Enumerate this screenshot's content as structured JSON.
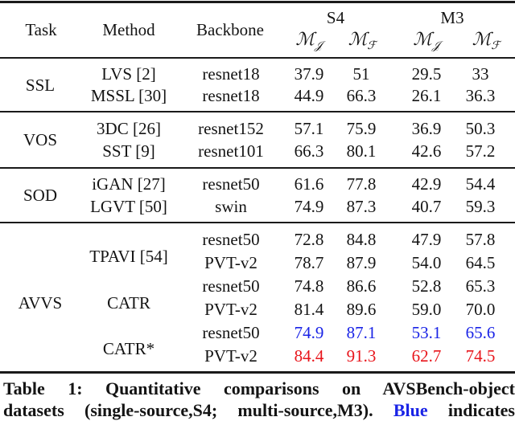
{
  "header": {
    "task": "Task",
    "method": "Method",
    "backbone": "Backbone",
    "groups": [
      "S4",
      "M3"
    ],
    "metric_main": "ℳ",
    "metric_j_sub": "𝒥",
    "metric_f_sub": "ℱ"
  },
  "colors": {
    "second_best": "#1a24e6",
    "best": "#e8151b",
    "text": "#141414"
  },
  "rows": [
    {
      "task": "SSL",
      "method": "LVS [2]",
      "backbone": "resnet18",
      "s4_j": "37.9",
      "s4_f": "51",
      "m3_j": "29.5",
      "m3_f": "33",
      "highlight": "none"
    },
    {
      "task": "",
      "method": "MSSL [30]",
      "backbone": "resnet18",
      "s4_j": "44.9",
      "s4_f": "66.3",
      "m3_j": "26.1",
      "m3_f": "36.3",
      "highlight": "none"
    },
    {
      "task": "VOS",
      "method": "3DC [26]",
      "backbone": "resnet152",
      "s4_j": "57.1",
      "s4_f": "75.9",
      "m3_j": "36.9",
      "m3_f": "50.3",
      "highlight": "none"
    },
    {
      "task": "",
      "method": "SST [9]",
      "backbone": "resnet101",
      "s4_j": "66.3",
      "s4_f": "80.1",
      "m3_j": "42.6",
      "m3_f": "57.2",
      "highlight": "none"
    },
    {
      "task": "SOD",
      "method": "iGAN [27]",
      "backbone": "resnet50",
      "s4_j": "61.6",
      "s4_f": "77.8",
      "m3_j": "42.9",
      "m3_f": "54.4",
      "highlight": "none"
    },
    {
      "task": "",
      "method": "LGVT [50]",
      "backbone": "swin",
      "s4_j": "74.9",
      "s4_f": "87.3",
      "m3_j": "40.7",
      "m3_f": "59.3",
      "highlight": "none"
    },
    {
      "task": "AVVS",
      "method": "TPAVI [54]",
      "backbone": "resnet50",
      "s4_j": "72.8",
      "s4_f": "84.8",
      "m3_j": "47.9",
      "m3_f": "57.8",
      "highlight": "none"
    },
    {
      "task": "",
      "method": "",
      "backbone": "PVT-v2",
      "s4_j": "78.7",
      "s4_f": "87.9",
      "m3_j": "54.0",
      "m3_f": "64.5",
      "highlight": "none"
    },
    {
      "task": "",
      "method": "CATR",
      "backbone": "resnet50",
      "s4_j": "74.8",
      "s4_f": "86.6",
      "m3_j": "52.8",
      "m3_f": "65.3",
      "highlight": "none"
    },
    {
      "task": "",
      "method": "",
      "backbone": "PVT-v2",
      "s4_j": "81.4",
      "s4_f": "89.6",
      "m3_j": "59.0",
      "m3_f": "70.0",
      "highlight": "none"
    },
    {
      "task": "",
      "method": "CATR*",
      "backbone": "resnet50",
      "s4_j": "74.9",
      "s4_f": "87.1",
      "m3_j": "53.1",
      "m3_f": "65.6",
      "highlight": "blue"
    },
    {
      "task": "",
      "method": "",
      "backbone": "PVT-v2",
      "s4_j": "84.4",
      "s4_f": "91.3",
      "m3_j": "62.7",
      "m3_f": "74.5",
      "highlight": "red"
    }
  ],
  "caption": {
    "line1": "Table 1: Quantitative comparisons on AVSBench-object",
    "line2_pre": "datasets (single-source,S4; multi-source,M3).",
    "line2_blue": "Blue",
    "line2_post": "indicates"
  }
}
